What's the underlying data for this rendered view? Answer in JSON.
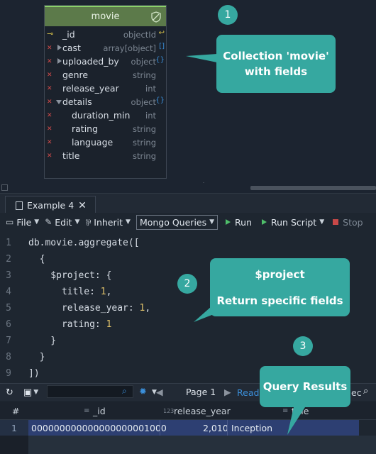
{
  "entity": {
    "title": "movie",
    "fields": [
      {
        "name": "_id",
        "type": "objectId",
        "marker": "key",
        "suffix": "link"
      },
      {
        "name": "cast",
        "type": "array[object]",
        "marker": "x",
        "expand": "collapsed",
        "suffix": "[]"
      },
      {
        "name": "uploaded_by",
        "type": "object",
        "marker": "x",
        "expand": "collapsed",
        "suffix": "{}"
      },
      {
        "name": "genre",
        "type": "string",
        "marker": "x"
      },
      {
        "name": "release_year",
        "type": "int",
        "marker": "x"
      },
      {
        "name": "details",
        "type": "object",
        "marker": "x",
        "expand": "expanded",
        "suffix": "{}"
      },
      {
        "name": "duration_min",
        "type": "int",
        "marker": "x",
        "child": true
      },
      {
        "name": "rating",
        "type": "string",
        "marker": "x",
        "child": true
      },
      {
        "name": "language",
        "type": "string",
        "marker": "x",
        "child": true
      },
      {
        "name": "title",
        "type": "string",
        "marker": "x"
      }
    ]
  },
  "callouts": {
    "one": {
      "badge": "1",
      "line1": "Collection 'movie'",
      "line2": "with fields"
    },
    "two": {
      "badge": "2",
      "line1": "$project",
      "line2": "Return specific fields"
    },
    "three": {
      "badge": "3",
      "line1": "Query Results"
    }
  },
  "tab": {
    "label": "Example 4",
    "close": "✕"
  },
  "toolbar": {
    "file": "File",
    "edit": "Edit",
    "inherit": "Inherit",
    "mode": "Mongo Queries",
    "run": "Run",
    "run_script": "Run Script",
    "stop": "Stop"
  },
  "editor": {
    "lines": [
      {
        "n": "1",
        "text": "db.movie.aggregate(["
      },
      {
        "n": "2",
        "text": "  {"
      },
      {
        "n": "3",
        "text": "    $project: {"
      },
      {
        "n": "4",
        "text": "      title: ",
        "num": "1",
        "tail": ","
      },
      {
        "n": "5",
        "text": "      release_year: ",
        "num": "1",
        "tail": ","
      },
      {
        "n": "6",
        "text": "      rating: ",
        "num": "1",
        "tail": ""
      },
      {
        "n": "7",
        "text": "    }"
      },
      {
        "n": "8",
        "text": "  }"
      },
      {
        "n": "9",
        "text": "])"
      }
    ]
  },
  "results": {
    "page_label": "Page 1",
    "read_label": "Read",
    "ec_label": "ec",
    "columns": {
      "num": "#",
      "id": "_id",
      "release_year": "release_year",
      "title": "title"
    },
    "rows": [
      {
        "num": "1",
        "id": "000000000000000000001000",
        "release_year": "2,010",
        "title": "Inception"
      }
    ]
  }
}
